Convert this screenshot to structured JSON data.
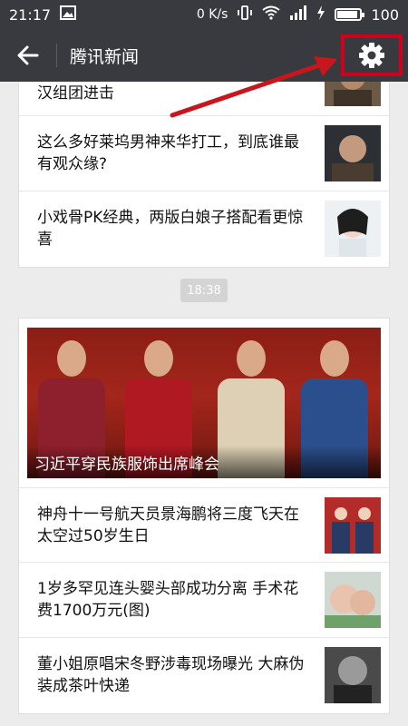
{
  "statusbar": {
    "time": "21:17",
    "net_speed": "0 K/s",
    "battery_level": "100"
  },
  "header": {
    "back_icon": "arrow-left-icon",
    "title": "腾讯新闻",
    "settings_icon": "gear-icon"
  },
  "card1": {
    "items": [
      {
        "title": "汉组团进击"
      },
      {
        "title": "这么多好莱坞男神来华打工，到底谁最有观众缘?"
      },
      {
        "title": "小戏骨PK经典，两版白娘子搭配看更惊喜"
      }
    ]
  },
  "time_separator": "18:38",
  "card2": {
    "hero": {
      "caption": "习近平穿民族服饰出席峰会"
    },
    "items": [
      {
        "title": "神舟十一号航天员景海鹏将三度飞天在太空过50岁生日"
      },
      {
        "title": "1岁多罕见连头婴头部成功分离 手术花费1700万元(图)"
      },
      {
        "title": "董小姐原唱宋冬野涉毒现场曝光 大麻伪装成茶叶快递"
      }
    ]
  },
  "colors": {
    "toolbar": "#393a3f",
    "highlight": "#d0021b",
    "background": "#ececec"
  }
}
